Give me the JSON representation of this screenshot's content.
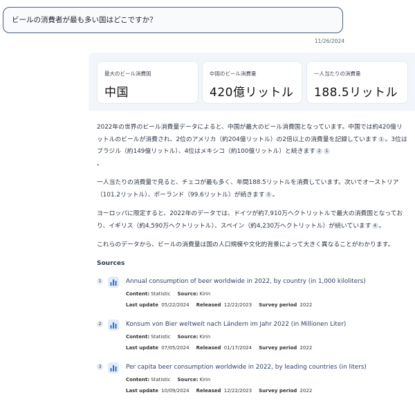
{
  "question": {
    "text": "ビールの消費者が最も多い国はどこですか？",
    "date": "11/26/2024"
  },
  "cards": [
    {
      "label": "最大のビール消費国",
      "value": "中国"
    },
    {
      "label": "中国のビール消費量",
      "value": "420億リットル"
    },
    {
      "label": "一人当たりの消費量",
      "value": "188.5リットル"
    }
  ],
  "answer": {
    "p1_a": "2022年の世界のビール消費量データによると、中国が最大のビール消費国となっています。中国では約420億リットルのビールが消費され、2位のアメリカ（約204億リットル）の2倍以上の消費量を記録しています",
    "p1_b": "。3位はブラジル（約149億リットル）、4位はメキシコ（約100億リットル）と続きます",
    "p1_c": "。",
    "p2_a": "一人当たりの消費量で見ると、チェコが最も多く、年間188.5リットルを消費しています。次いでオーストリア（101.2リットル）、ポーランド（99.6リットル）が続きます",
    "p2_b": "。",
    "p3_a": "ヨーロッパに限定すると、2022年のデータでは、ドイツが約7,910万ヘクトリットルで最大の消費国となっており、イギリス（約4,590万ヘクトリットル）、スペイン（約4,230万ヘクトリットル）が続いています",
    "p3_b": "。",
    "p4": "これらのデータから、ビールの消費量は国の人口規模や文化的背景によって大きく異なることがわかります。",
    "cites": {
      "c1": "1",
      "c2": "2",
      "c3": "1",
      "c4": "3",
      "c5": "4"
    }
  },
  "sources": {
    "heading": "Sources",
    "labels": {
      "content": "Content:",
      "source": "Source:",
      "last_update": "Last update",
      "released": "Released",
      "survey_period": "Survey period"
    },
    "items": [
      {
        "num": "1",
        "title": "Annual consumption of beer worldwide in 2022, by country (in 1,000 kiloliters)",
        "content": "Statistic",
        "source": "Kirin",
        "last_update": "05/22/2024",
        "released": "12/22/2023",
        "survey": "2022"
      },
      {
        "num": "2",
        "title": "Konsum von Bier weltweit nach Ländern im Jahr 2022 (in Millionen Liter)",
        "content": "Statistic",
        "source": "Kirin",
        "last_update": "07/05/2024",
        "released": "01/17/2024",
        "survey": "2022"
      },
      {
        "num": "3",
        "title": "Per capita beer consumption worldwide in 2022, by leading countries (in liters)",
        "content": "Statistic",
        "source": "Kirin",
        "last_update": "10/09/2024",
        "released": "12/22/2023",
        "survey": "2022"
      }
    ]
  },
  "colors": {
    "accent": "#2f6fd6",
    "panel": "#f2f6fa",
    "border": "#4a5f7a"
  },
  "icons": {
    "source_icon": "bar-chart-icon"
  }
}
